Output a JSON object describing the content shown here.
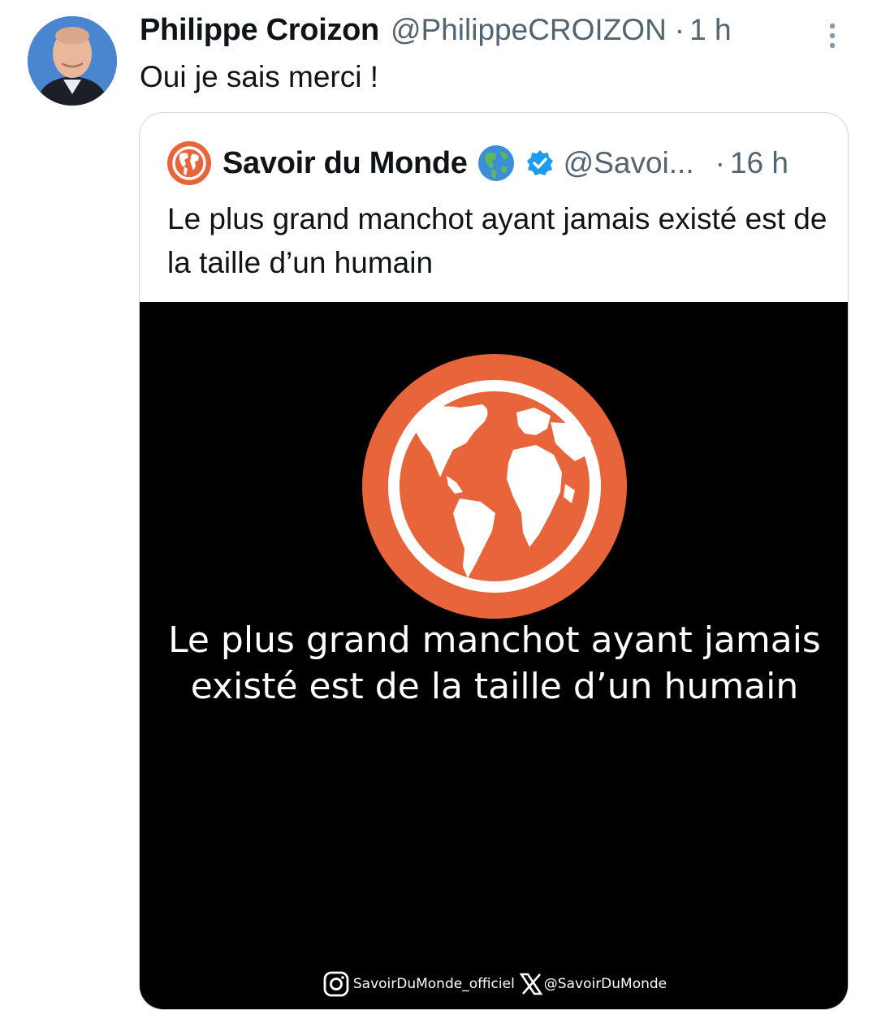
{
  "tweet": {
    "author": {
      "display_name": "Philippe Croizon",
      "handle": "@PhilippeCROIZON",
      "avatar_icon": "profile-photo"
    },
    "separator": "·",
    "time": "1 h",
    "text": "Oui je sais merci !",
    "more_icon": "vertical-ellipsis-icon"
  },
  "quoted_tweet": {
    "author": {
      "display_name": "Savoir du Monde",
      "emoji": "globe-americas-emoji",
      "verified_icon": "verified-badge-icon",
      "handle": "@Savoi...",
      "avatar_icon": "orange-globe-logo"
    },
    "separator": "·",
    "time": "16 h",
    "text": "Le plus grand manchot ayant jamais existé est de la taille d’un humain",
    "media": {
      "background": "#000000",
      "logo_color": "#e8643a",
      "caption": "Le plus grand manchot ayant jamais existé est de la taille d’un humain",
      "footer": {
        "instagram": "SavoirDuMonde_officiel",
        "x_handle": "@SavoirDuMonde"
      }
    }
  },
  "colors": {
    "text_primary": "#0f1419",
    "text_secondary": "#536471",
    "border": "#cfd9de",
    "verified": "#1d9bf0",
    "brand_orange": "#e8643a"
  }
}
